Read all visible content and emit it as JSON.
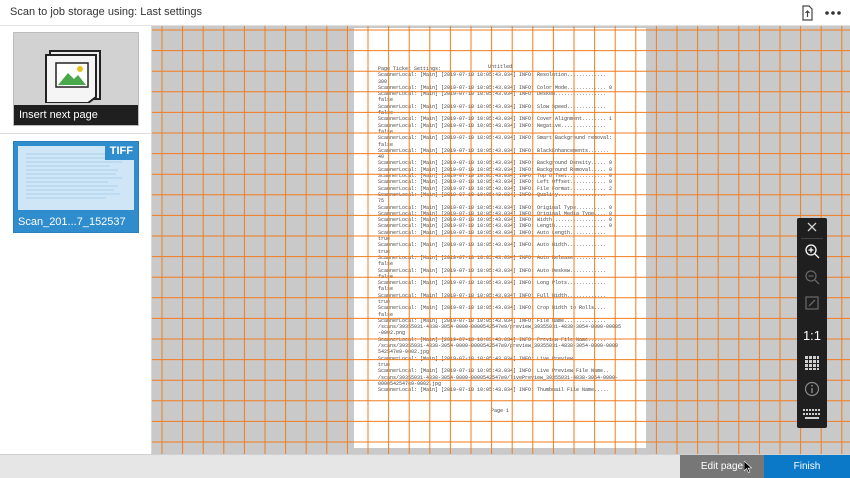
{
  "header": {
    "title": "Scan to job storage using: Last settings",
    "icons": [
      "export-icon",
      "more-options-icon"
    ]
  },
  "sidebar": {
    "insert_card": {
      "label": "Insert next page",
      "icon": "image-placeholder-icon"
    },
    "scan_card": {
      "label": "Scan_201...7_152537",
      "badge": "TIFF",
      "selected": true
    }
  },
  "preview": {
    "grid_visible": true,
    "grid_color": "#f07d20",
    "document": {
      "title": "Untitled",
      "footer": "Page 1",
      "lines": [
        "Page Ticket Settings:",
        "ScannerLocal: [Main] [2019-07-10 10:05:43.034] INFO: Resolution.............",
        "300",
        "ScannerLocal: [Main] [2019-07-10 10:05:43.034] INFO: Color Mode............. 0",
        "ScannerLocal: [Main] [2019-07-10 10:05:43.034] INFO: Deskew.................",
        "false",
        "ScannerLocal: [Main] [2019-07-10 10:05:43.034] INFO: Slow Speed.............",
        "false",
        "ScannerLocal: [Main] [2019-07-10 10:05:43.034] INFO: Cover Alignment........ 1",
        "ScannerLocal: [Main] [2019-07-10 10:05:43.034] INFO: Negative...............",
        "false",
        "ScannerLocal: [Main] [2019-07-10 10:05:43.034] INFO: Smart Background removal:",
        "false",
        "ScannerLocal: [Main] [2019-07-10 10:05:43.034] INFO: BlackEnhancements.......",
        "40",
        "ScannerLocal: [Main] [2019-07-10 10:05:43.034] INFO: Background Density..... 0",
        "ScannerLocal: [Main] [2019-07-10 10:05:43.034] INFO: Background Removal..... 0",
        "ScannerLocal: [Main] [2019-07-10 10:05:43.034] INFO: Top Offset............. 0",
        "ScannerLocal: [Main] [2019-07-10 10:05:43.034] INFO: Left Offset............ 0",
        "ScannerLocal: [Main] [2019-07-10 10:05:43.034] INFO: File Format............ 2",
        "ScannerLocal: [Main] [2019-07-10 10:05:43.034] INFO: Quality................",
        "75",
        "ScannerLocal: [Main] [2019-07-10 10:05:43.034] INFO: Original Type.......... 0",
        "ScannerLocal: [Main] [2019-07-10 10:05:43.034] INFO: Original Media Type.... 0",
        "ScannerLocal: [Main] [2019-07-10 10:05:43.034] INFO: Width.................. 0",
        "ScannerLocal: [Main] [2019-07-10 10:05:43.034] INFO: Length................. 0",
        "ScannerLocal: [Main] [2019-07-10 10:05:43.034] INFO: Auto Length............",
        "true",
        "ScannerLocal: [Main] [2019-07-10 10:05:43.034] INFO: Auto Width.............",
        "true",
        "ScannerLocal: [Main] [2019-07-10 10:05:43.034] INFO: Auto Release...........",
        "false",
        "ScannerLocal: [Main] [2019-07-10 10:05:43.034] INFO: Auto Deskew............",
        "false",
        "ScannerLocal: [Main] [2019-07-10 10:05:43.034] INFO: Long Plots.............",
        "false",
        "ScannerLocal: [Main] [2019-07-10 10:05:43.034] INFO: Full Width.............",
        "true",
        "ScannerLocal: [Main] [2019-07-10 10:05:43.034] INFO: Crop Width to Rolls....",
        "false",
        "ScannerLocal: [Main] [2019-07-10 10:05:43.034] INFO: File Name..............",
        "/scans/39355031-4838-3054-0000-0000542547e9/preview_39355031-4838-3054-0000-00005",
        "-0002.png",
        "ScannerLocal: [Main] [2019-07-10 10:05:43.034] INFO: Preview File Name......",
        "/scans/39355031-4838-3054-0000-0000542547e9/preview_39355031-4838-3054-0000-0000",
        "542547e9-0002.jpg",
        "ScannerLocal: [Main] [2019-07-10 10:05:43.034] INFO: Live Preview...........",
        "true",
        "ScannerLocal: [Main] [2019-07-10 10:05:43.034] INFO: Live Preview File Name..",
        "/scans/39355031-4838-3054-0000-0000542547e9/livePreview_39355031-4838-3054-0000-",
        "0000542547e9-0002.jpg",
        "ScannerLocal: [Main] [2019-07-10 10:05:43.034] INFO: Thumbnail File Name....."
      ]
    }
  },
  "zoom_toolbar": {
    "actual_size_label": "1:1",
    "icons": [
      "close-icon",
      "zoom-in-icon",
      "zoom-out-icon",
      "fit-to-screen-icon",
      "actual-size-icon",
      "grid-icon",
      "info-icon",
      "keyboard-icon"
    ]
  },
  "footer": {
    "edit_page_label": "Edit page",
    "finish_label": "Finish",
    "finish_color": "#0b78c8"
  }
}
